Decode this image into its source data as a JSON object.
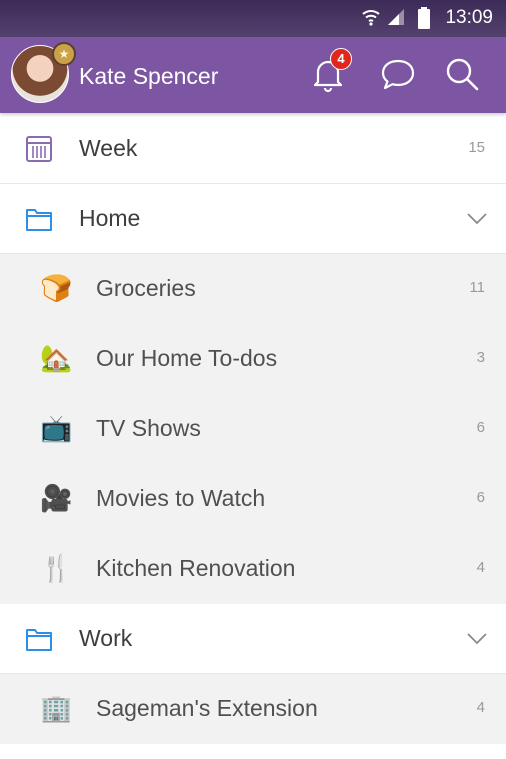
{
  "status_bar": {
    "time": "13:09"
  },
  "header": {
    "user_name": "Kate Spencer",
    "notification_count": "4"
  },
  "lists": [
    {
      "label": "Week",
      "count": "15",
      "icon": "calendar-icon",
      "type": "smart"
    },
    {
      "label": "Home",
      "icon": "folder-icon",
      "type": "folder",
      "expanded": true
    },
    {
      "label": "Groceries",
      "count": "11",
      "emoji": "🍞",
      "type": "sub"
    },
    {
      "label": "Our Home To-dos",
      "count": "3",
      "emoji": "🏡",
      "type": "sub"
    },
    {
      "label": "TV Shows",
      "count": "6",
      "emoji": "📺",
      "type": "sub"
    },
    {
      "label": "Movies to Watch",
      "count": "6",
      "emoji": "🎥",
      "type": "sub"
    },
    {
      "label": "Kitchen Renovation",
      "count": "4",
      "emoji": "🍴",
      "type": "sub"
    },
    {
      "label": "Work",
      "icon": "folder-icon",
      "type": "folder",
      "expanded": true
    },
    {
      "label": "Sageman's Extension",
      "count": "4",
      "emoji": "🏢",
      "type": "sub"
    }
  ],
  "colors": {
    "header": "#7d56a3",
    "folder_icon": "#2d8ee6",
    "badge": "#e0261d"
  }
}
